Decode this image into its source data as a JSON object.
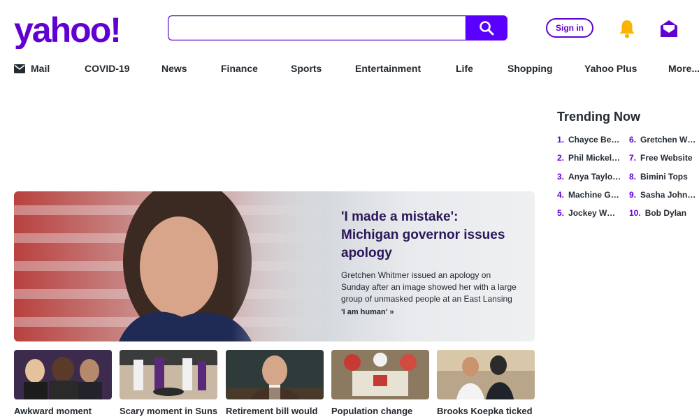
{
  "header": {
    "logo_text": "yahoo!",
    "search": {
      "placeholder": "",
      "value": ""
    },
    "signin_label": "Sign in"
  },
  "nav": {
    "items": [
      {
        "label": "Mail",
        "icon": "mail-icon"
      },
      {
        "label": "COVID-19"
      },
      {
        "label": "News"
      },
      {
        "label": "Finance"
      },
      {
        "label": "Sports"
      },
      {
        "label": "Entertainment"
      },
      {
        "label": "Life"
      },
      {
        "label": "Shopping"
      },
      {
        "label": "Yahoo Plus"
      },
      {
        "label": "More..."
      }
    ]
  },
  "trending": {
    "title": "Trending Now",
    "items": [
      {
        "num": "1.",
        "label": "Chayce Beckham"
      },
      {
        "num": "2.",
        "label": "Phil Mickelson"
      },
      {
        "num": "3.",
        "label": "Anya Taylor-Joy"
      },
      {
        "num": "4.",
        "label": "Machine Gun Kelly"
      },
      {
        "num": "5.",
        "label": "Jockey World Record"
      },
      {
        "num": "6.",
        "label": "Gretchen Whitmer"
      },
      {
        "num": "7.",
        "label": "Free Website"
      },
      {
        "num": "8.",
        "label": "Bimini Tops"
      },
      {
        "num": "9.",
        "label": "Sasha Johnson"
      },
      {
        "num": "10.",
        "label": "Bob Dylan"
      }
    ]
  },
  "hero": {
    "title": "'I made a mistake': Michigan governor issues apology",
    "description": "Gretchen Whitmer issued an apology on Sunday after an image showed her with a large group of unmasked people at an East Lansing restaurant.",
    "link_label": "'I am human' »"
  },
  "cards": [
    {
      "title": "Awkward moment"
    },
    {
      "title": "Scary moment in Suns'"
    },
    {
      "title": "Retirement bill would"
    },
    {
      "title": "Population change"
    },
    {
      "title": "Brooks Koepka ticked"
    }
  ],
  "colors": {
    "brand": "#6001d2",
    "search_button": "#5a00ff",
    "bell": "#fbb300"
  }
}
